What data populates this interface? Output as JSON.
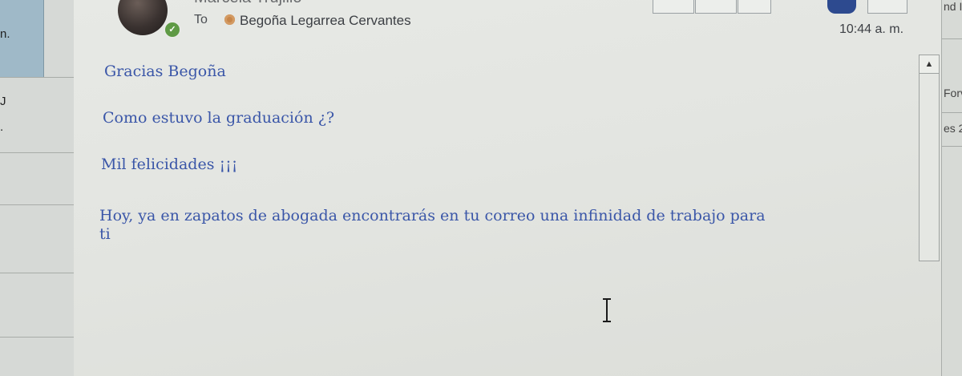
{
  "left_pane": {
    "snippet_1": "n.",
    "snippet_2": "J",
    "snippet_3": "."
  },
  "header": {
    "sender_name": "Marcela Trujillo",
    "to_label": "To",
    "recipient": "Begoña Legarrea Cervantes",
    "time": "10:44 a. m."
  },
  "message": {
    "lines": [
      "Gracias Begoña",
      "Como estuvo la graduación ¿?",
      "Mil felicidades ¡¡¡",
      "Hoy, ya en zapatos de abogada  encontrarás en tu correo una infinidad de trabajo para",
      "ti"
    ]
  },
  "right_pane": {
    "snippet_1": "nd I",
    "snippet_2": "Forv",
    "snippet_3": "es 2"
  },
  "colors": {
    "body_text": "#3a56a8",
    "presence": "#5f9a45",
    "recipient_status": "#c7864a"
  },
  "icons": {
    "presence": "checkmark-icon",
    "scroll_up": "up-arrow-icon",
    "cursor": "text-cursor-icon"
  }
}
